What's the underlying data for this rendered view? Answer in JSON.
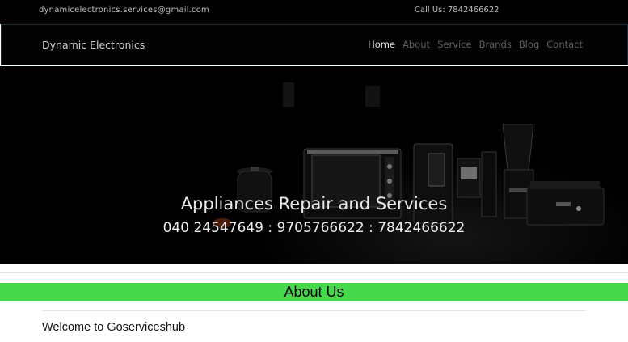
{
  "topbar": {
    "email": "dynamicelectronics.services@gmail.com",
    "call": "Call Us: 7842466622"
  },
  "navbar": {
    "brand": "Dynamic Electronics",
    "items": [
      {
        "label": "Home",
        "active": true
      },
      {
        "label": "About",
        "active": false
      },
      {
        "label": "Service",
        "active": false
      },
      {
        "label": "Brands",
        "active": false
      },
      {
        "label": "Blog",
        "active": false
      },
      {
        "label": "Contact",
        "active": false
      }
    ]
  },
  "hero": {
    "title": "Appliances Repair and Services",
    "phones": "040 24547649 : 9705766622 : 7842466622"
  },
  "about": {
    "heading": "About Us",
    "welcome": "Welcome to Goserviceshub"
  },
  "colors": {
    "topbar_bg": "#000000",
    "nav_active": "#e6e6e6",
    "nav_inactive": "#5f5f5f",
    "about_band": "#46d94b"
  }
}
